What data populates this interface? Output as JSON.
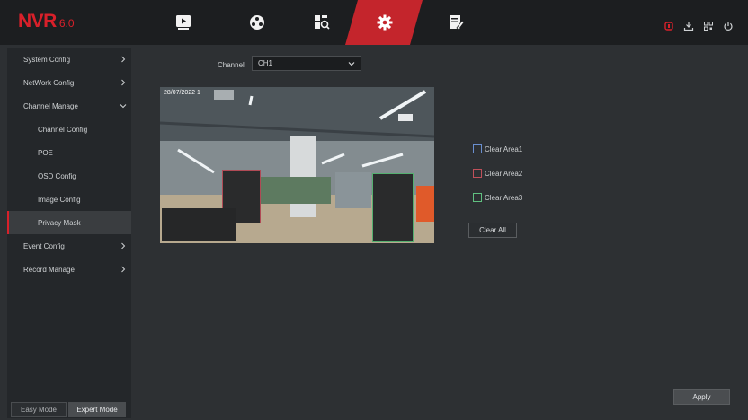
{
  "logo": {
    "brand": "NVR",
    "version": "6.0"
  },
  "top_nav": [
    {
      "icon": "playback-icon",
      "active": false
    },
    {
      "icon": "smart-icon",
      "active": false
    },
    {
      "icon": "search-icon",
      "active": false
    },
    {
      "icon": "settings-icon",
      "active": true
    },
    {
      "icon": "maintenance-icon",
      "active": false
    }
  ],
  "system_icons": [
    "alarm-icon",
    "download-icon",
    "qr-icon",
    "power-icon"
  ],
  "sidebar": {
    "items": [
      {
        "label": "System Config",
        "level": 1,
        "expanded": false
      },
      {
        "label": "NetWork Config",
        "level": 1,
        "expanded": false
      },
      {
        "label": "Channel Manage",
        "level": 1,
        "expanded": true
      },
      {
        "label": "Channel Config",
        "level": 2
      },
      {
        "label": "POE",
        "level": 2
      },
      {
        "label": "OSD Config",
        "level": 2
      },
      {
        "label": "Image Config",
        "level": 2
      },
      {
        "label": "Privacy Mask",
        "level": 2,
        "active": true
      },
      {
        "label": "Event Config",
        "level": 1,
        "expanded": false
      },
      {
        "label": "Record Manage",
        "level": 1,
        "expanded": false
      }
    ],
    "easy_mode": "Easy Mode",
    "expert_mode": "Expert Mode"
  },
  "channel": {
    "label": "Channel",
    "value": "CH1"
  },
  "preview": {
    "timestamp": "28/07/2022 1"
  },
  "areas": [
    {
      "label": "Clear Area1",
      "color": "#6a8fd0"
    },
    {
      "label": "Clear Area2",
      "color": "#c0505a"
    },
    {
      "label": "Clear Area3",
      "color": "#60c080"
    }
  ],
  "buttons": {
    "clear_all": "Clear All",
    "apply": "Apply"
  },
  "colors": {
    "accent": "#d8202a"
  }
}
